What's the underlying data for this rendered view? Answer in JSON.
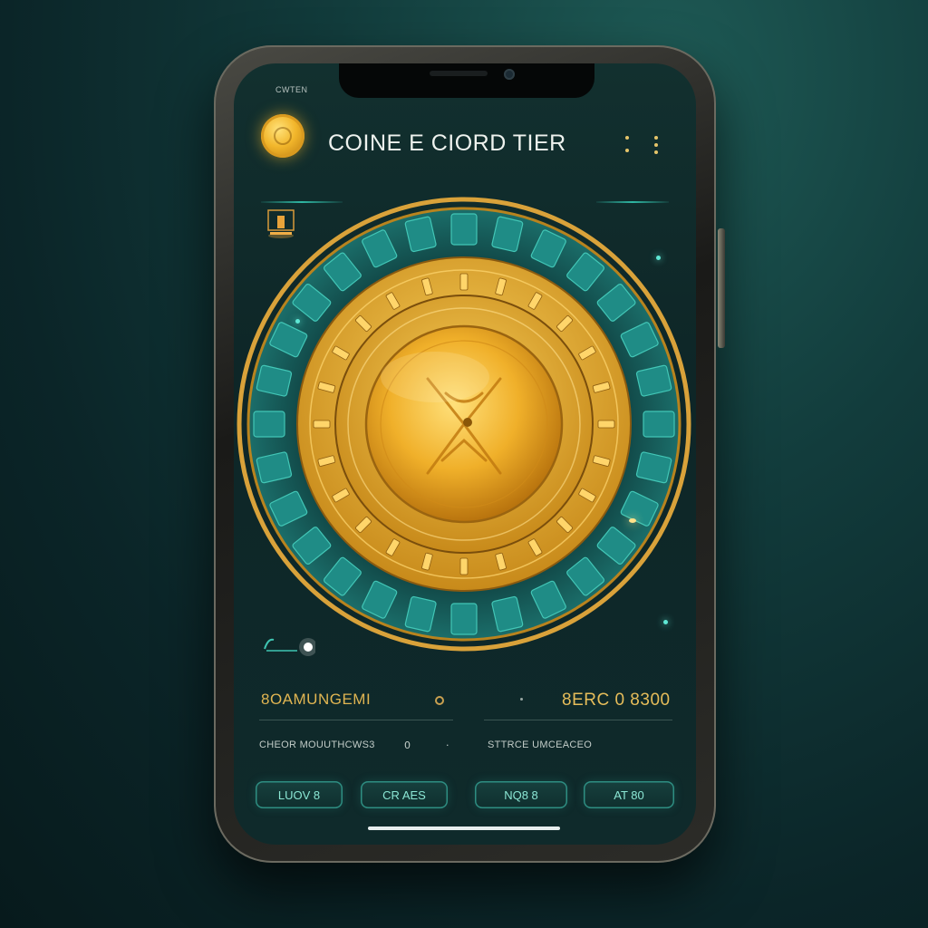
{
  "status_bar": {
    "label": "CWTEN"
  },
  "header": {
    "title": "COINE E CIORD TIER",
    "logo_icon": "coin-logo-icon",
    "menu_icon": "menu-dots-icon"
  },
  "dial": {
    "center_icon": "coin-emblem-icon",
    "colors": {
      "gold": "#f2b62b",
      "teal": "#1f8c86"
    }
  },
  "stats": {
    "left_label": "8OAMUNGEMI",
    "right_value": "8ERC 0 8300"
  },
  "details": {
    "left_text": "CHEOR MOUUTHCWS3",
    "left_mark_1": "0",
    "left_mark_2": "·",
    "right_text": "STTRCE UMCEACEO"
  },
  "actions": [
    {
      "label": "LUOV 8"
    },
    {
      "label": "CR AES"
    },
    {
      "label": "NQ8 8"
    },
    {
      "label": "AT 80"
    }
  ]
}
